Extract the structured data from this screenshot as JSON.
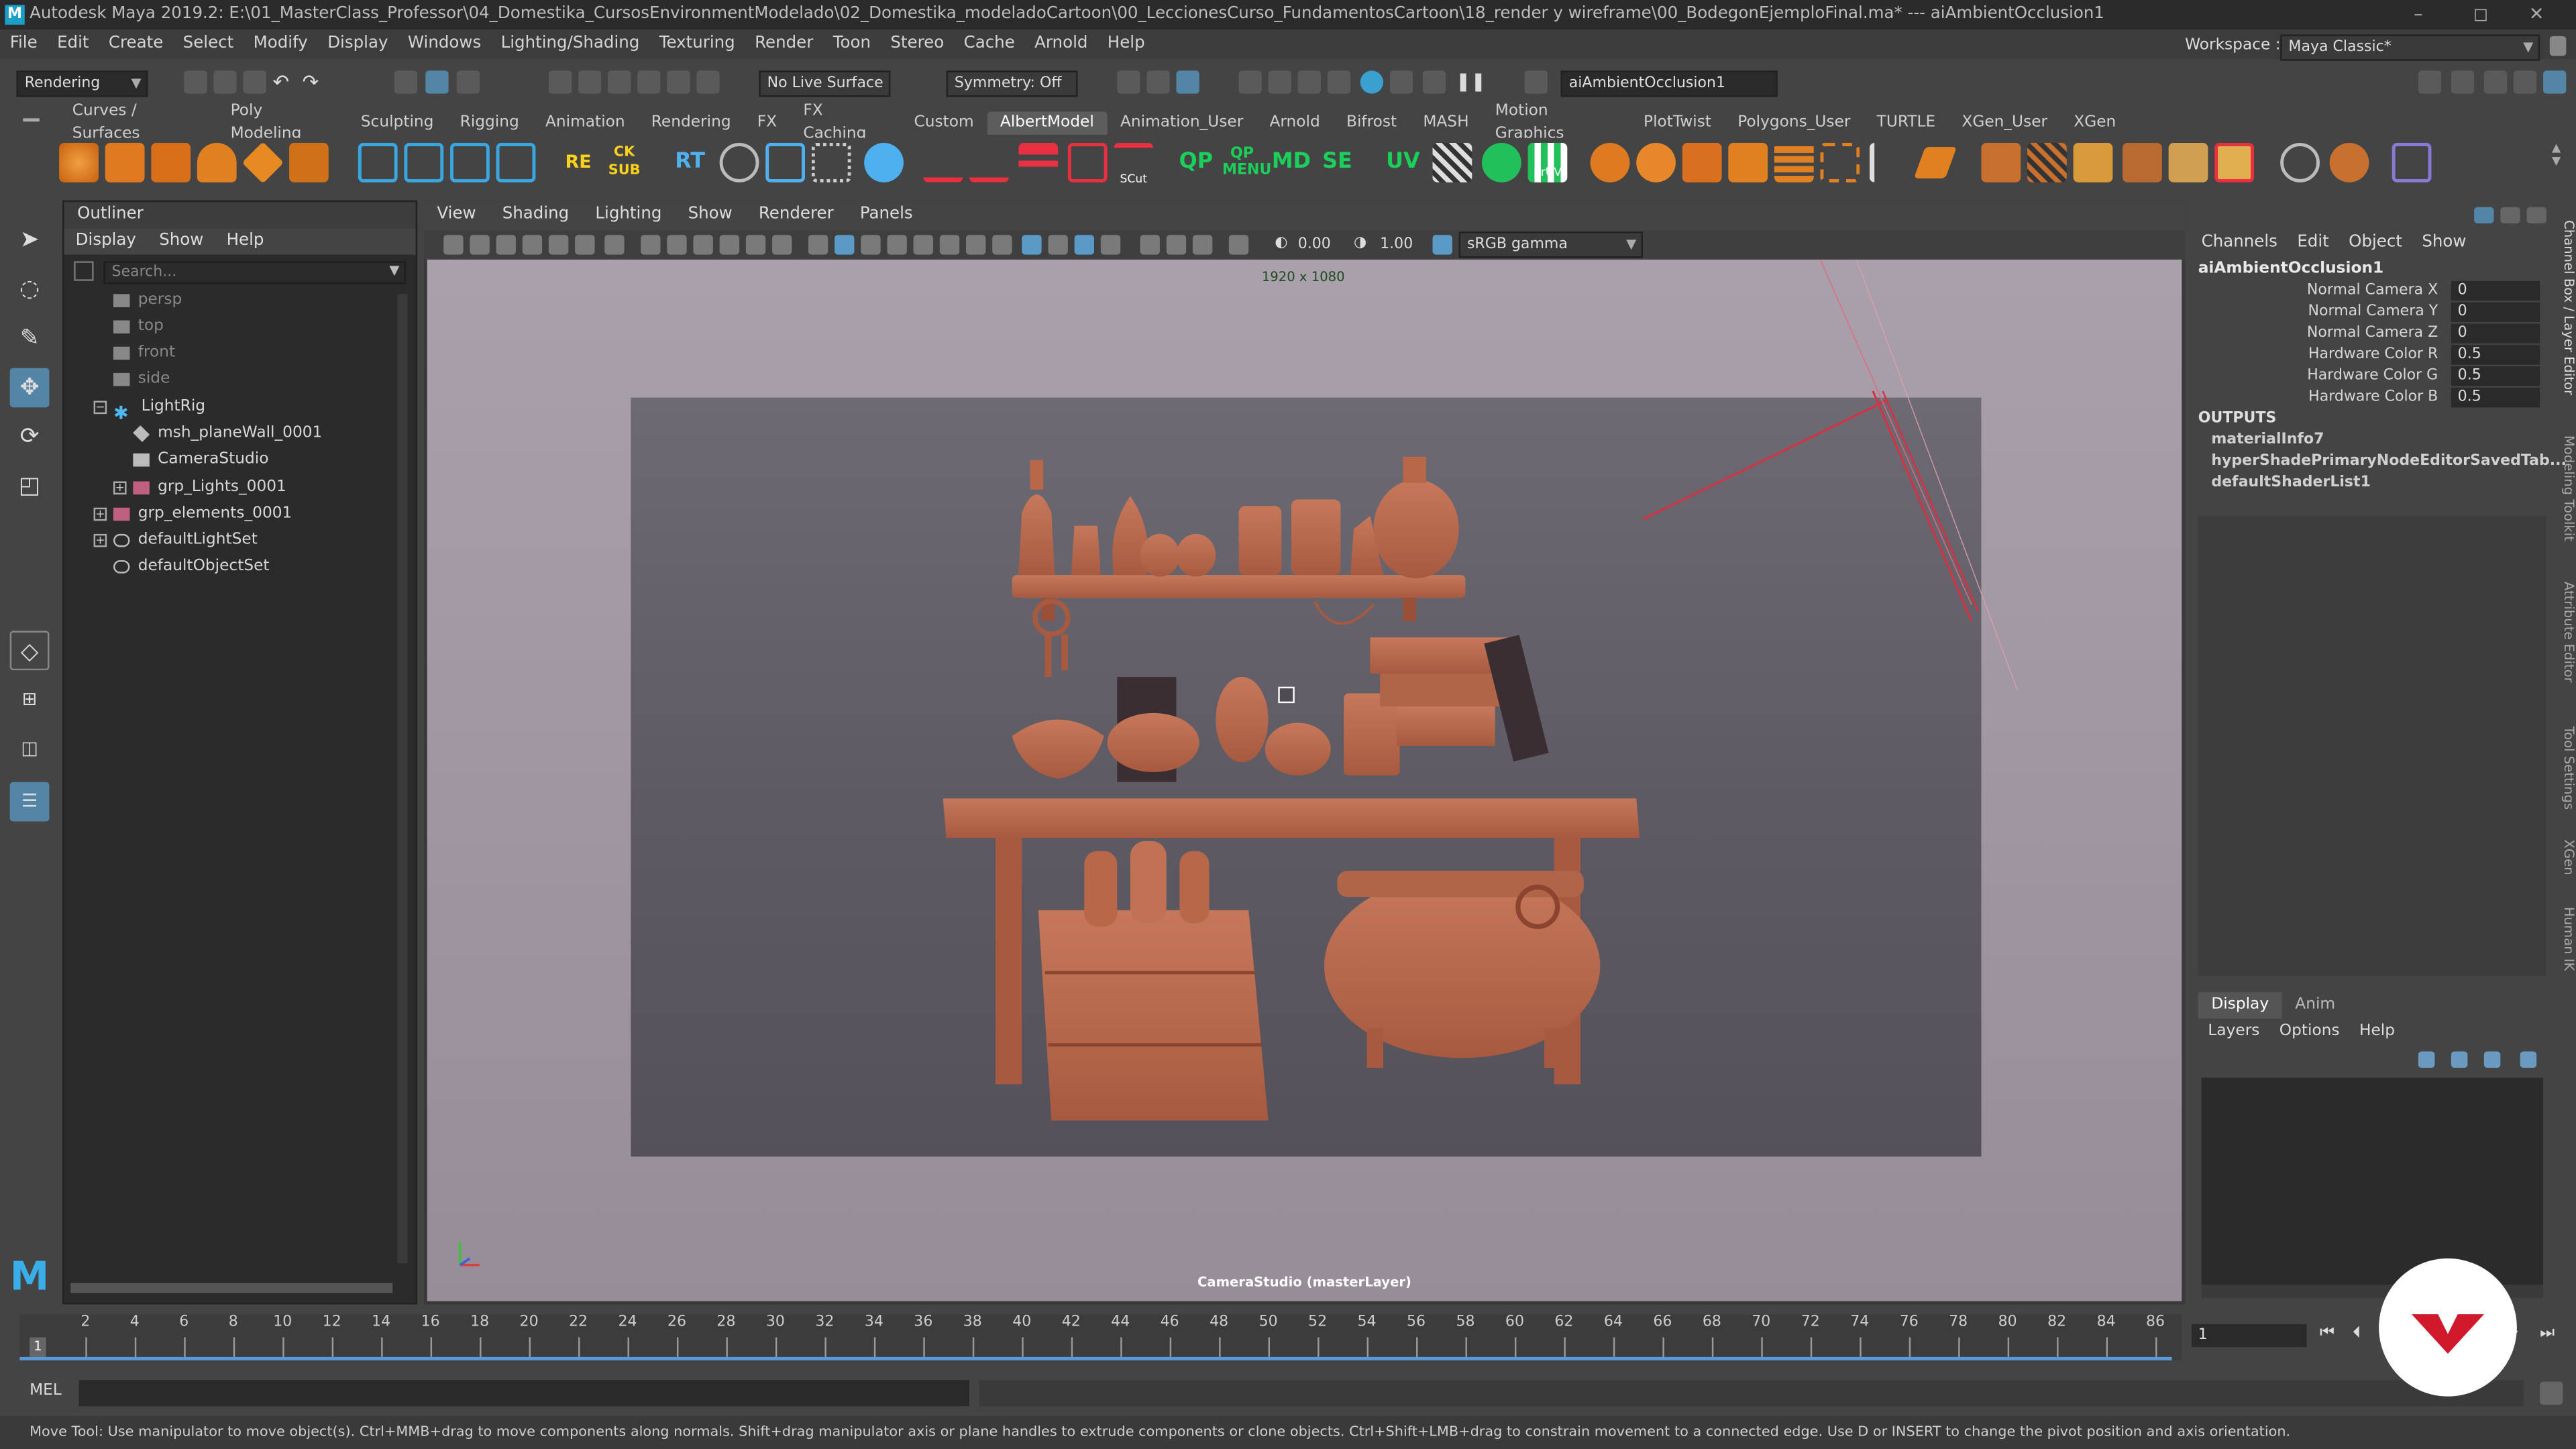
{
  "window": {
    "title": "Autodesk Maya 2019.2: E:\\01_MasterClass_Professor\\04_Domestika_CursosEnvironmentModelado\\02_Domestika_modeladoCartoon\\00_LeccionesCurso_FundamentosCartoon\\18_render y wireframe\\00_BodegonEjemploFinal.ma*  ---  aiAmbientOcclusion1",
    "app_icon_label": "M",
    "min_label": "–",
    "max_label": "◻",
    "close_label": "✕"
  },
  "menubar": {
    "items": [
      "File",
      "Edit",
      "Create",
      "Select",
      "Modify",
      "Display",
      "Windows",
      "Lighting/Shading",
      "Texturing",
      "Render",
      "Toon",
      "Stereo",
      "Cache",
      "Arnold",
      "Help"
    ],
    "workspace_label": "Workspace :",
    "workspace_value": "Maya Classic*"
  },
  "statusline": {
    "menuset": "Rendering",
    "live_surface": "No Live Surface",
    "symmetry": "Symmetry: Off",
    "node_field": "aiAmbientOcclusion1"
  },
  "shelf": {
    "tabs": [
      "Curves / Surfaces",
      "Poly Modeling",
      "Sculpting",
      "Rigging",
      "Animation",
      "Rendering",
      "FX",
      "FX Caching",
      "Custom",
      "AlbertModel",
      "Animation_User",
      "Arnold",
      "Bifrost",
      "MASH",
      "Motion Graphics",
      "PlotTwist",
      "Polygons_User",
      "TURTLE",
      "XGen_User",
      "XGen"
    ],
    "active_tab": "AlbertModel",
    "text_icons": [
      "RE",
      "CK SUB",
      "RT",
      "QP",
      "QP MENU",
      "MD",
      "SE",
      "UV",
      "SCut",
      "prUV"
    ]
  },
  "outliner": {
    "title": "Outliner",
    "menu": [
      "Display",
      "Show",
      "Help"
    ],
    "search_placeholder": "Search...",
    "items": [
      {
        "label": "persp",
        "dim": true
      },
      {
        "label": "top",
        "dim": true
      },
      {
        "label": "front",
        "dim": true
      },
      {
        "label": "side",
        "dim": true
      },
      {
        "label": "LightRig",
        "dim": false
      },
      {
        "label": "msh_planeWall_0001",
        "dim": false
      },
      {
        "label": "CameraStudio",
        "dim": false
      },
      {
        "label": "grp_Lights_0001",
        "dim": false
      },
      {
        "label": "grp_elements_0001",
        "dim": false
      },
      {
        "label": "defaultLightSet",
        "dim": false
      },
      {
        "label": "defaultObjectSet",
        "dim": false
      }
    ]
  },
  "viewport": {
    "menu": [
      "View",
      "Shading",
      "Lighting",
      "Show",
      "Renderer",
      "Panels"
    ],
    "exposure": "0.00",
    "gamma": "1.00",
    "color_space": "sRGB gamma",
    "resolution": "1920 x 1080",
    "camera_label": "CameraStudio (masterLayer)"
  },
  "channelbox": {
    "menu": [
      "Channels",
      "Edit",
      "Object",
      "Show"
    ],
    "node": "aiAmbientOcclusion1",
    "attributes": [
      {
        "label": "Normal Camera X",
        "value": "0"
      },
      {
        "label": "Normal Camera Y",
        "value": "0"
      },
      {
        "label": "Normal Camera Z",
        "value": "0"
      },
      {
        "label": "Hardware Color R",
        "value": "0.5"
      },
      {
        "label": "Hardware Color G",
        "value": "0.5"
      },
      {
        "label": "Hardware Color B",
        "value": "0.5"
      }
    ],
    "outputs_label": "OUTPUTS",
    "outputs": [
      "materialInfo7",
      "hyperShadePrimaryNodeEditorSavedTab...",
      "defaultShaderList1"
    ]
  },
  "layers": {
    "tabs": [
      "Display",
      "Anim"
    ],
    "active_tab": "Display",
    "menu": [
      "Layers",
      "Options",
      "Help"
    ]
  },
  "side_tabs": [
    "Channel Box / Layer Editor",
    "Modeling Toolkit",
    "Attribute Editor",
    "Tool Settings",
    "XGen",
    "Human IK"
  ],
  "timeslider": {
    "ticks": [
      "1",
      "2",
      "4",
      "6",
      "8",
      "10",
      "12",
      "14",
      "16",
      "18",
      "20",
      "22",
      "24",
      "26",
      "28",
      "30",
      "32",
      "34",
      "36",
      "38",
      "40",
      "42",
      "44",
      "46",
      "48",
      "50",
      "52",
      "54",
      "56",
      "58",
      "60",
      "62",
      "64",
      "66",
      "68",
      "70",
      "72",
      "74",
      "76",
      "78",
      "80",
      "82",
      "84",
      "86"
    ],
    "current_frame": "1"
  },
  "commandline": {
    "label": "MEL"
  },
  "helpline": {
    "text": "Move Tool: Use manipulator to move object(s). Ctrl+MMB+drag to move components along normals. Shift+drag manipulator axis or plane handles to extrude components or clone objects. Ctrl+Shift+LMB+drag to constrain movement to a connected edge. Use D or INSERT to change the pivot position and axis orientation."
  },
  "colors": {
    "accent": "#5285a6",
    "clay": "#b8664a",
    "viewport_bg": "#a39aa5",
    "wire_red": "#d83040",
    "brand_red": "#d0192b"
  }
}
